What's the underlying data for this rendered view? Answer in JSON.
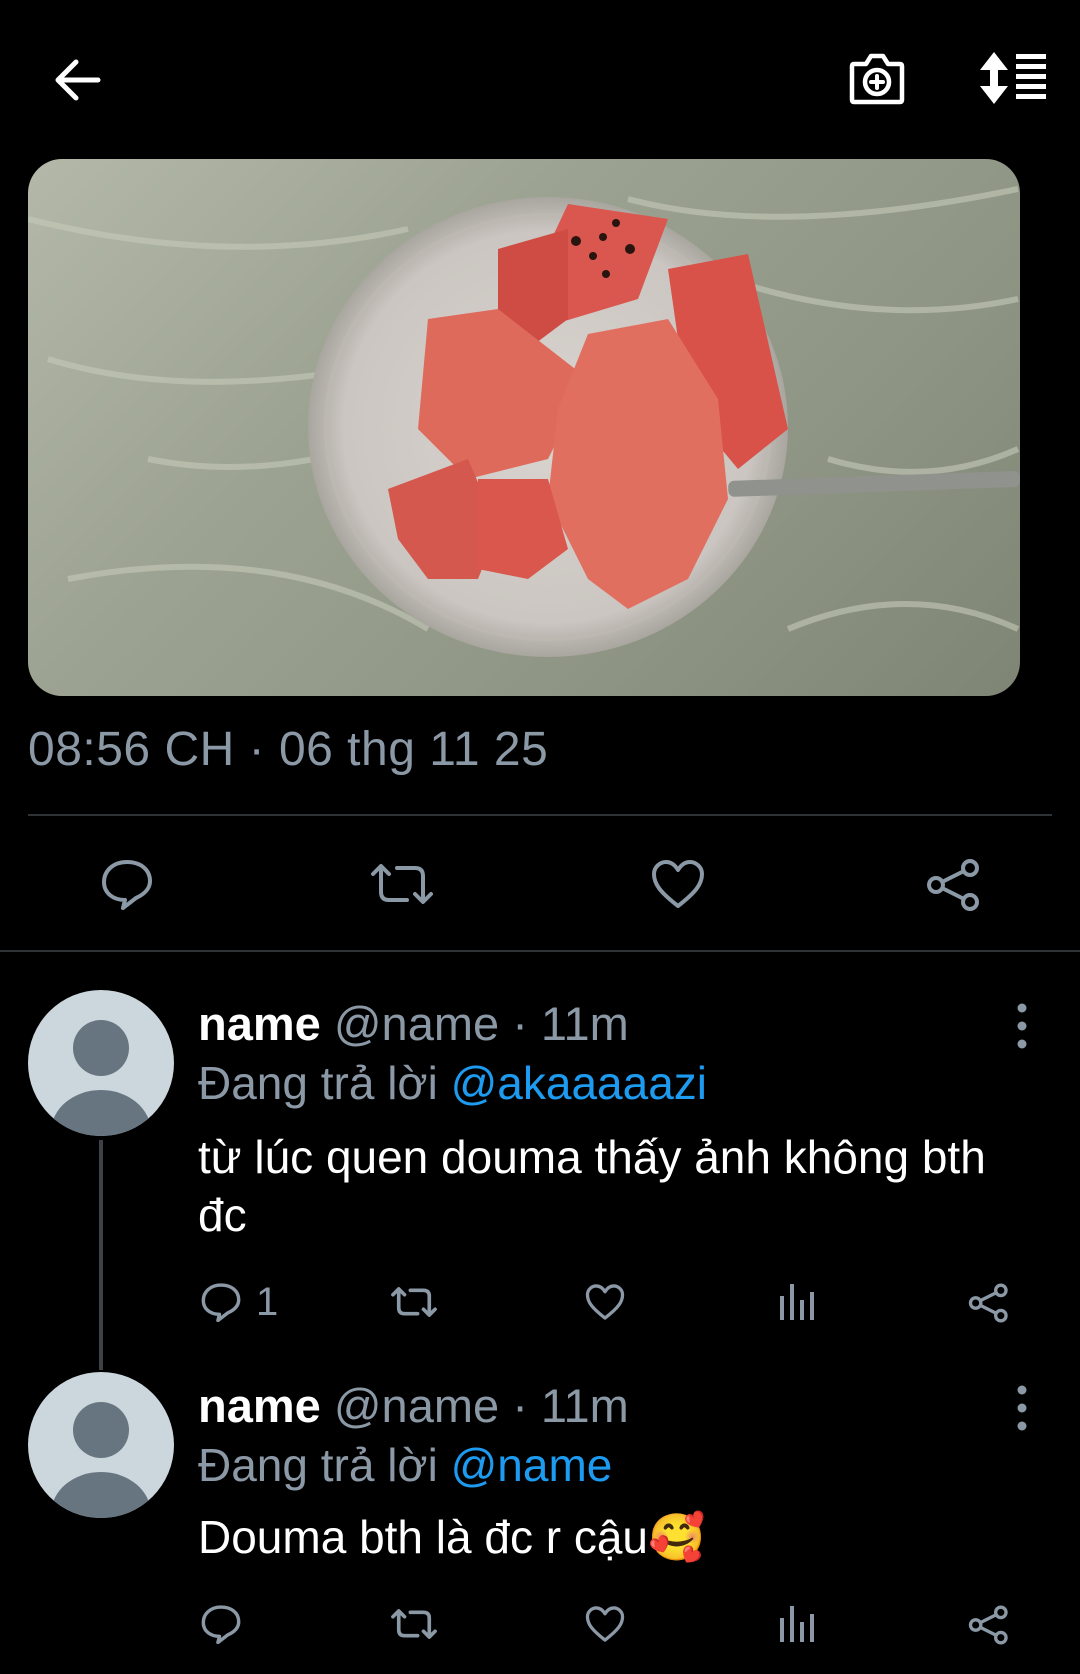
{
  "header": {
    "back_icon": "arrow-left-icon",
    "camera_icon": "camera-plus-icon",
    "sort_icon": "sort-list-icon"
  },
  "tweet": {
    "time": "08:56 CH",
    "separator": " · ",
    "date": "06 thg 11 25",
    "actions": [
      "reply-icon",
      "retweet-icon",
      "like-icon",
      "share-icon"
    ]
  },
  "replies": [
    {
      "name": "name",
      "handle": "@name",
      "age": "· 11m",
      "replying_prefix": "Đang trả lời",
      "replying_to": "@akaaaaazi",
      "text": "từ lúc quen douma thấy ảnh không bth đc",
      "reply_count": "1"
    },
    {
      "name": "name",
      "handle": "@name",
      "age": "· 11m",
      "replying_prefix": "Đang trả lời",
      "replying_to": "@name",
      "text": "Douma bth là đc r cậu🥰",
      "reply_count": ""
    }
  ],
  "colors": {
    "background": "#000000",
    "muted": "#8b98a5",
    "accent": "#1d9bf0",
    "divider": "#2f3336"
  }
}
